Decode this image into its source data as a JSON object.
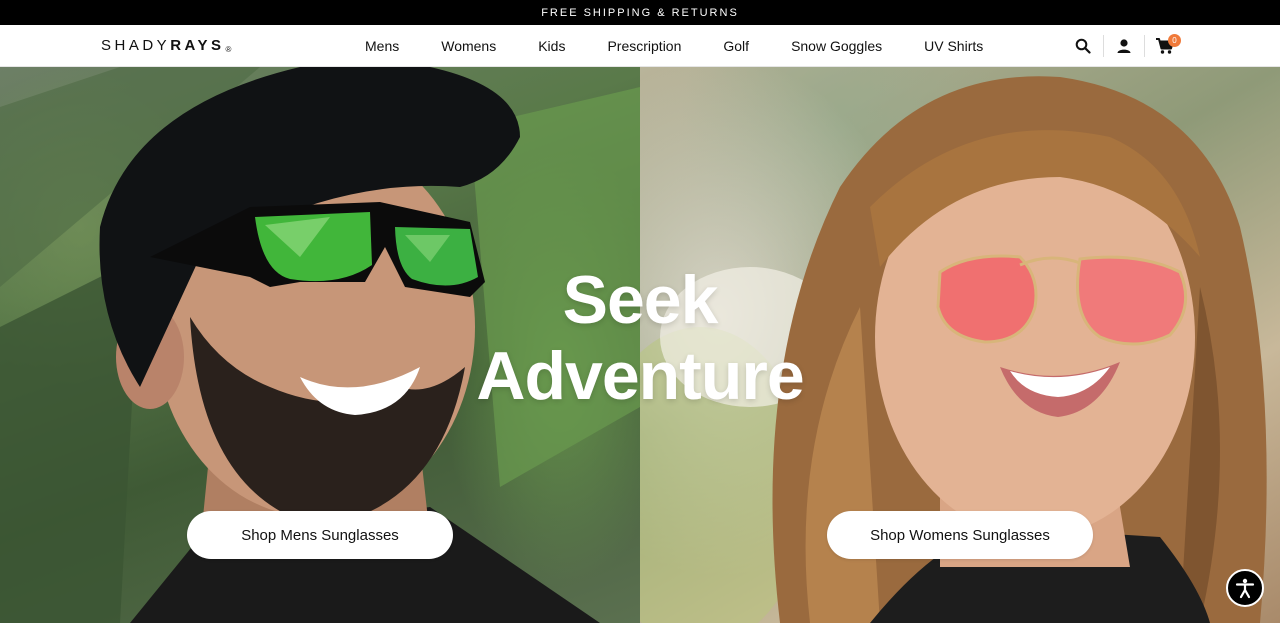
{
  "announcement": {
    "text": "FREE SHIPPING & RETURNS"
  },
  "logo": {
    "part1": "SHADY",
    "part2": "RAYS",
    "reg": "®"
  },
  "nav": {
    "items": [
      {
        "label": "Mens"
      },
      {
        "label": "Womens"
      },
      {
        "label": "Kids"
      },
      {
        "label": "Prescription"
      },
      {
        "label": "Golf"
      },
      {
        "label": "Snow Goggles"
      },
      {
        "label": "UV Shirts"
      }
    ]
  },
  "header_icons": {
    "search": "search-icon",
    "account": "user-icon",
    "cart": "cart-icon",
    "cart_count": "0"
  },
  "hero": {
    "title_line1": "Seek",
    "title_line2": "Adventure",
    "cta_men": "Shop Mens Sunglasses",
    "cta_women": "Shop Womens Sunglasses"
  },
  "colors": {
    "accent": "#f07a3a",
    "announce_bg": "#000000"
  },
  "accessibility": {
    "icon": "accessibility-icon"
  }
}
